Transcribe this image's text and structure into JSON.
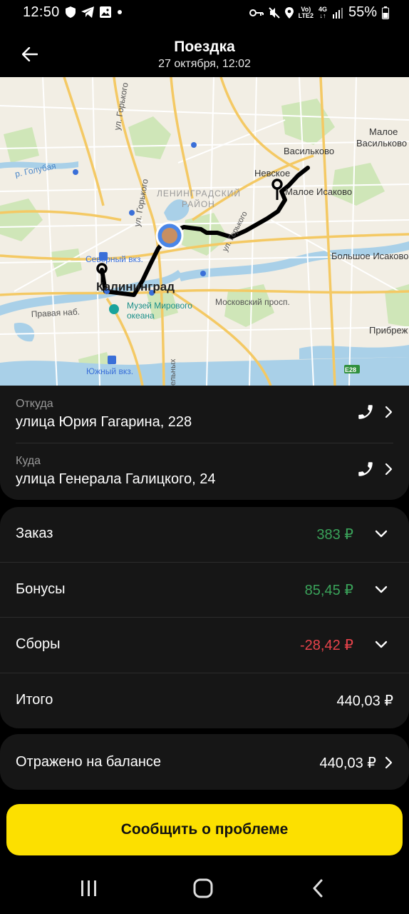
{
  "status_bar": {
    "time": "12:50",
    "battery": "55%",
    "network_top": "Vo)",
    "network_bottom": "LTE2",
    "gen": "4G",
    "icons": [
      "shield-icon",
      "telegram-icon",
      "gallery-icon",
      "dot-icon",
      "key-icon",
      "mute-icon",
      "location-icon",
      "signal-icon",
      "battery-icon"
    ]
  },
  "header": {
    "title": "Поездка",
    "subtitle": "27 октября, 12:02"
  },
  "map": {
    "labels": {
      "ul_gorkogo_1": "ул. Горького",
      "ul_gorkogo_2": "ул. Горького",
      "r_golubaya": "р. Голубая",
      "leningradsky_1": "ЛЕНИНГРАДСКИЙ",
      "leningradsky_2": "РАЙОН",
      "vasilkovo": "Васильково",
      "maloe_vasilkovo_1": "Малое",
      "maloe_vasilkovo_2": "Васильково",
      "nevskoe": "Невское",
      "maloe_isakovo": "Малое Исаково",
      "bolshoe_isakovo": "Большое Исаково",
      "severny": "Северный вкз.",
      "kaliningrad": "Калининград",
      "pravaya": "Правая наб.",
      "museum_1": "Музей Мирового",
      "museum_2": "океана",
      "moskovsky": "Московский просп.",
      "pribrezhny": "Прибреж",
      "yuzhny": "Южный вкз.",
      "e28": "E28",
      "ul_right": "ул. Горького",
      "ul_bottom": "ельных"
    }
  },
  "trip": {
    "from_caption": "Откуда",
    "from_address": "улица Юрия Гагарина, 228",
    "to_caption": "Куда",
    "to_address": "улица Генерала Галицкого, 24"
  },
  "payment": {
    "rows": [
      {
        "label": "Заказ",
        "value": "383 ₽",
        "color": "#3aa35a"
      },
      {
        "label": "Бонусы",
        "value": "85,45 ₽",
        "color": "#3aa35a"
      },
      {
        "label": "Сборы",
        "value": "-28,42 ₽",
        "color": "#e8434b"
      }
    ],
    "total_label": "Итого",
    "total_value": "440,03 ₽"
  },
  "balance": {
    "label": "Отражено на балансе",
    "value": "440,03 ₽"
  },
  "report_button": "Сообщить о проблеме",
  "colors": {
    "accent": "#fce000",
    "positive": "#3aa35a",
    "negative": "#e8434b",
    "card": "#161616"
  }
}
